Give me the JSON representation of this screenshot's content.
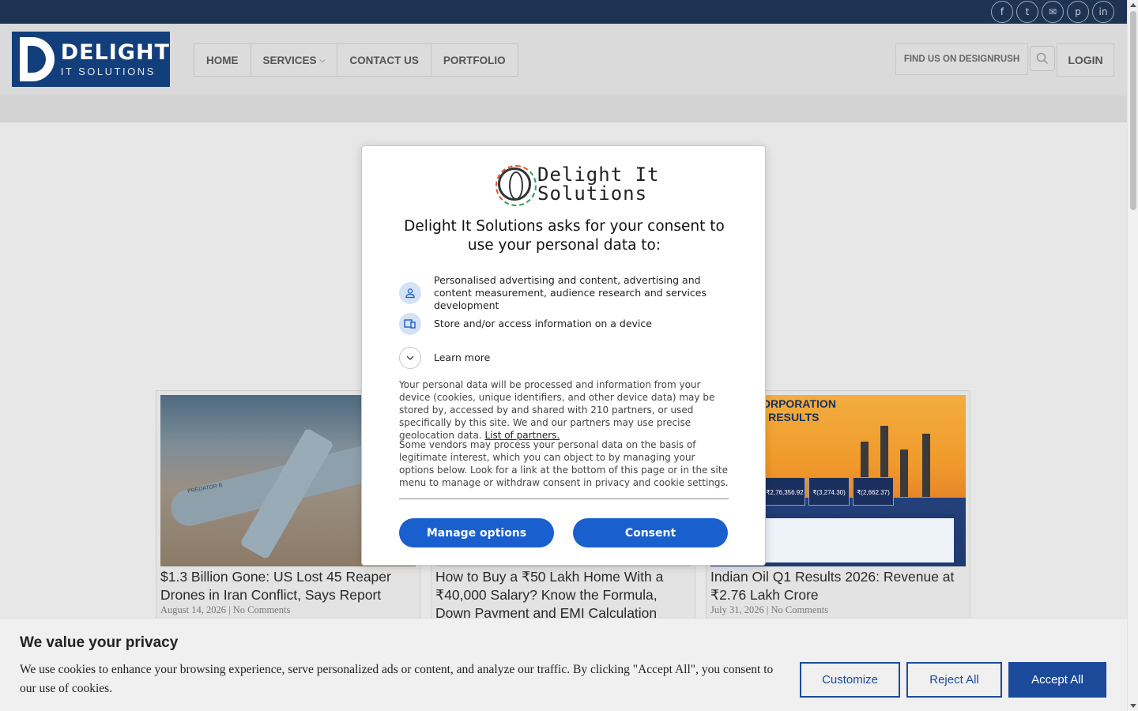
{
  "social": {
    "icons": [
      "facebook-icon",
      "twitter-icon",
      "email-icon",
      "pinterest-icon",
      "linkedin-icon"
    ]
  },
  "header": {
    "logo_title": "DELIGHT",
    "logo_subtitle": "IT SOLUTIONS",
    "nav": [
      "HOME",
      "SERVICES",
      "CONTACT US",
      "PORTFOLIO"
    ],
    "find_us": "FIND US ON DESIGNRUSH",
    "login": "LOGIN"
  },
  "cards": [
    {
      "title": "$1.3 Billion Gone: US Lost 45 Reaper Drones in Iran Conflict, Says Report",
      "meta": "August 14, 2026 | No Comments",
      "image_text": "PREDATOR B"
    },
    {
      "title": "How to Buy a ₹50 Lakh Home With a ₹40,000 Salary? Know the Formula, Down Payment and EMI Calculation",
      "meta": ""
    },
    {
      "title": "Indian Oil Q1 Results 2026: Revenue at ₹2.76 Lakh Crore",
      "meta": "July 31, 2026 | No Comments",
      "image_heading_1": "IAN OIL CORPORATION",
      "image_heading_2": "FY2026-27 RESULTS",
      "image_stats": [
        "₹2,76,356.92",
        "₹(3,274.30)",
        "₹(2,662.37)"
      ]
    }
  ],
  "consent_modal": {
    "brand_line1": "Delight It",
    "brand_line2": "Solutions",
    "heading": "Delight It Solutions asks for your consent to use your personal data to:",
    "purposes": [
      {
        "icon": "person-icon",
        "text": "Personalised advertising and content, advertising and content measurement, audience research and services development"
      },
      {
        "icon": "devices-icon",
        "text": "Store and/or access information on a device"
      }
    ],
    "learn_more": "Learn more",
    "para1": "Your personal data will be processed and information from your device (cookies, unique identifiers, and other device data) may be stored by, accessed by and shared with 210 partners, or used specifically by this site. We and our partners may use precise geolocation data.",
    "partners_link": "List of partners.",
    "para2": "Some vendors may process your personal data on the basis of legitimate interest, which you can object to by managing your options below. Look for a link at the bottom of this page or in the site menu to manage or withdraw consent in privacy and cookie settings.",
    "manage_options": "Manage options",
    "consent": "Consent",
    "accent_color": "#1a5fce"
  },
  "cookie_bar": {
    "title": "We value your privacy",
    "text": "We use cookies to enhance your browsing experience, serve personalized ads or content, and analyze our traffic. By clicking \"Accept All\", you consent to our use of cookies.",
    "customize": "Customize",
    "reject_all": "Reject All",
    "accept_all": "Accept All",
    "accent_color": "#1b4a9a"
  }
}
